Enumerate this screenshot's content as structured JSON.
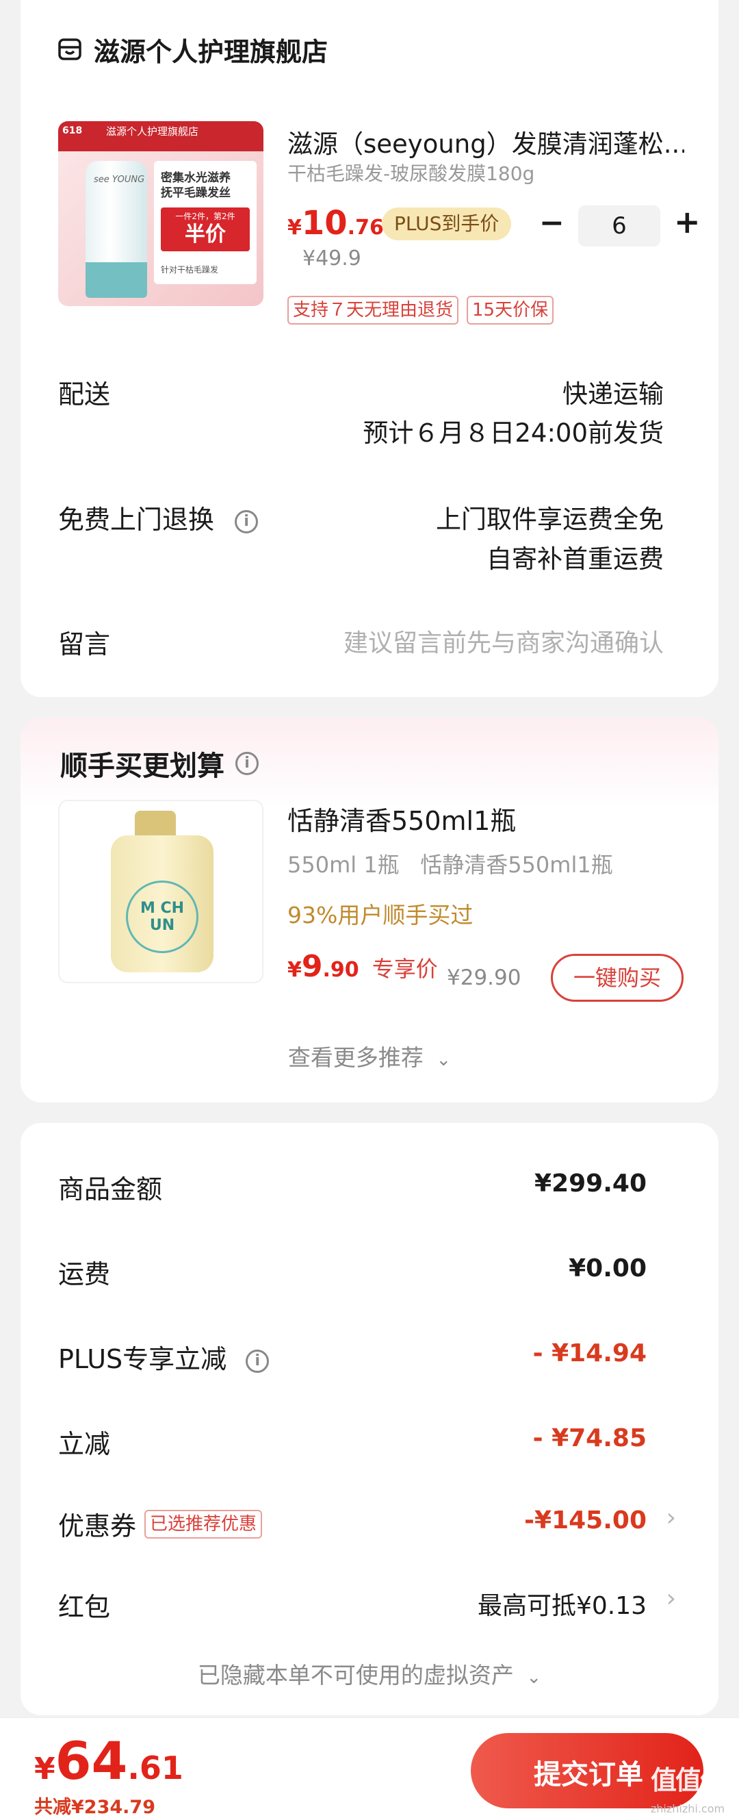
{
  "store": {
    "name": "滋源个人护理旗舰店",
    "icon": "store-icon"
  },
  "product": {
    "title": "滋源（seeyoung）发膜清润蓬松...",
    "spec": "干枯毛躁发-玻尿酸发膜180g",
    "price_symbol": "¥",
    "price_int": "10",
    "price_dec": ".76",
    "plus_badge": "PLUS到手价",
    "orig_price": "¥49.9",
    "qty": "6",
    "minus": "−",
    "plus": "+",
    "tags": [
      "支持７天无理由退货",
      "15天价保"
    ],
    "image": {
      "banner_store": "滋源个人护理旗舰店",
      "badge_618": "618",
      "brand": "see YOUNG",
      "line1": "密集水光滋养",
      "line2": "抚平毛躁发丝",
      "promo_small": "一件2件，第2件",
      "promo_big": "半价",
      "foot": "针对干枯毛躁发"
    }
  },
  "delivery": {
    "label": "配送",
    "method": "快递运输",
    "eta": "预计６月８日24:00前发货"
  },
  "returns": {
    "label": "免费上门退换",
    "line1": "上门取件享运费全免",
    "line2": "自寄补首重运费"
  },
  "note": {
    "label": "留言",
    "placeholder": "建议留言前先与商家沟通确认"
  },
  "addon": {
    "title": "顺手买更划算",
    "item_name": "恬静清香550ml1瓶",
    "item_spec": "550ml 1瓶   恬静清香550ml1瓶",
    "social": "93%用户顺手买过",
    "price_symbol": "¥",
    "price_int": "9",
    "price_dec": ".90",
    "price_label": "专享价",
    "orig_price": "¥29.90",
    "buy_button": "一键购买",
    "more": "查看更多推荐",
    "bottle_text": "M CH UN"
  },
  "summary": {
    "rows": [
      {
        "label": "商品金额",
        "value": "¥299.40"
      },
      {
        "label": "运费",
        "value": "¥0.00"
      },
      {
        "label": "PLUS专享立减",
        "value": "- ¥14.94"
      },
      {
        "label": "立减",
        "value": "- ¥74.85"
      },
      {
        "label": "优惠券",
        "badge": "已选推荐优惠",
        "value": "-¥145.00"
      },
      {
        "label": "红包",
        "value": "最高可抵¥0.13"
      }
    ],
    "hidden_assets": "已隐藏本单不可使用的虚拟资产"
  },
  "footer": {
    "price_symbol": "¥",
    "price_int": "64",
    "price_dec": ".61",
    "saved": "共减¥234.79",
    "submit": "提交订单"
  },
  "watermark": {
    "logo": "值值值",
    "url": "zhizhizhi.com"
  },
  "colors": {
    "accent_red": "#e2231a",
    "plus_gold": "#f7e7b4",
    "background": "#f2f2f2"
  }
}
